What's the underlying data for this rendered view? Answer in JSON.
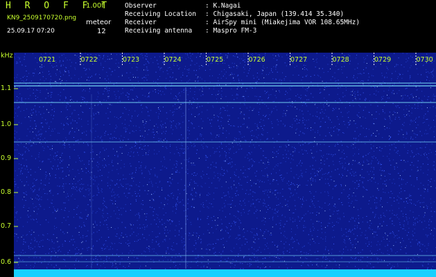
{
  "header": {
    "app_title": "H R O F F T",
    "version": "1.00f",
    "filename": "KN9_2509170720.png",
    "meteor_label": "meteor",
    "datetime": "25.09.17 07:20",
    "meteor_count": "12",
    "info": [
      {
        "label": "Observer",
        "value": ": K.Nagai"
      },
      {
        "label": "Receiving Location",
        "value": ": Chigasaki, Japan (139.414 35.340)"
      },
      {
        "label": "Receiver",
        "value": ": AirSpy mini (Miakejima VOR 108.65MHz)"
      },
      {
        "label": "Receiving antenna",
        "value": ": Maspro FM-3"
      }
    ]
  },
  "spectrogram": {
    "freq_unit": "kHz",
    "freq_ticks": [
      "1.1",
      "1.0",
      "0.9",
      "0.8",
      "0.7",
      "0.6"
    ],
    "time_ticks": [
      "0721",
      "0722",
      "0723",
      "0724",
      "0725",
      "0726",
      "0727",
      "0728",
      "0729",
      "0730"
    ],
    "colors": {
      "background": "#0d1a8c",
      "noise": "#3a5cff",
      "line": "#7fe8ff",
      "bottom_band": "#19d0ff",
      "axis": "#c8ff2e"
    }
  }
}
